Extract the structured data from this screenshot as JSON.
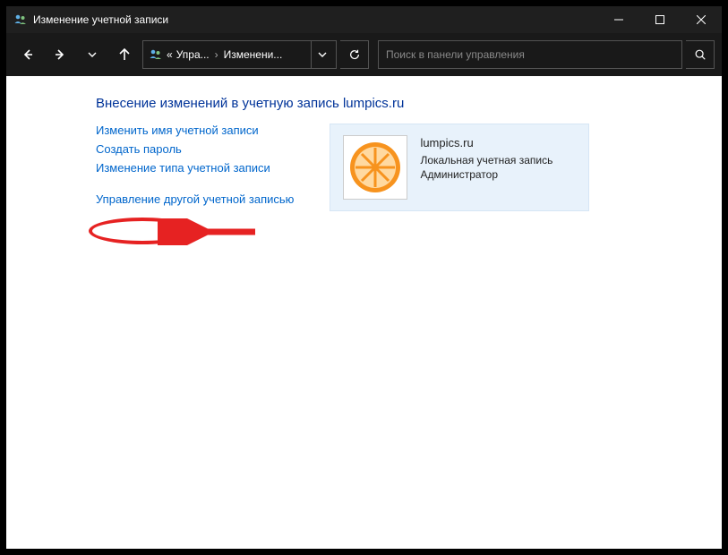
{
  "window": {
    "title": "Изменение учетной записи"
  },
  "breadcrumb": {
    "prefix": "«",
    "item1": "Упра...",
    "item2": "Изменени..."
  },
  "search": {
    "placeholder": "Поиск в панели управления"
  },
  "page": {
    "heading": "Внесение изменений в учетную запись lumpics.ru"
  },
  "actions": {
    "change_name": "Изменить имя учетной записи",
    "create_password": "Создать пароль",
    "change_type": "Изменение типа учетной записи",
    "manage_other": "Управление другой учетной записью"
  },
  "account": {
    "name": "lumpics.ru",
    "type": "Локальная учетная запись",
    "role": "Администратор"
  }
}
